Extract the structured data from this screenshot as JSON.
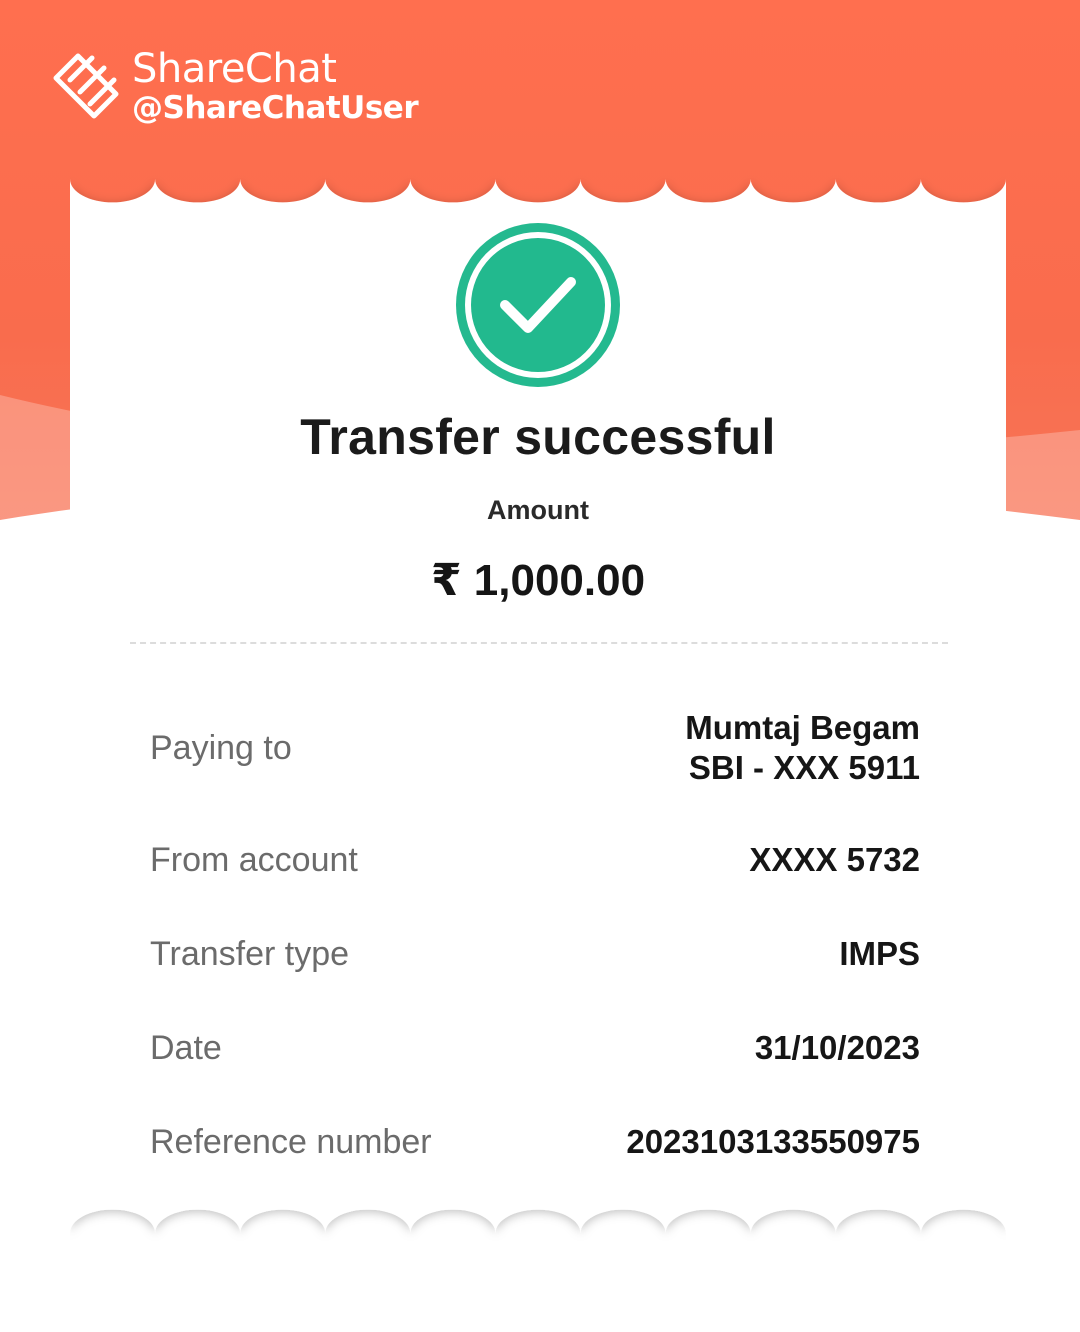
{
  "watermark": {
    "brand": "ShareChat",
    "user": "@ShareChatUser",
    "logo_icon": "sharechat-logo-icon"
  },
  "colors": {
    "background_top": "#ff6f4f",
    "success_green": "#22b98e",
    "text_dark": "#161616",
    "text_muted": "#6b6b6b"
  },
  "receipt": {
    "status_icon": "check-circle-icon",
    "title": "Transfer successful",
    "amount_label": "Amount",
    "amount_value": "₹ 1,000.00",
    "details": [
      {
        "label": "Paying to",
        "value_line1": "Mumtaj Begam",
        "value_line2": "SBI - XXX 5911"
      },
      {
        "label": "From account",
        "value": "XXXX 5732"
      },
      {
        "label": "Transfer type",
        "value": "IMPS"
      },
      {
        "label": "Date",
        "value": "31/10/2023"
      },
      {
        "label": "Reference number",
        "value": "2023103133550975"
      }
    ]
  }
}
